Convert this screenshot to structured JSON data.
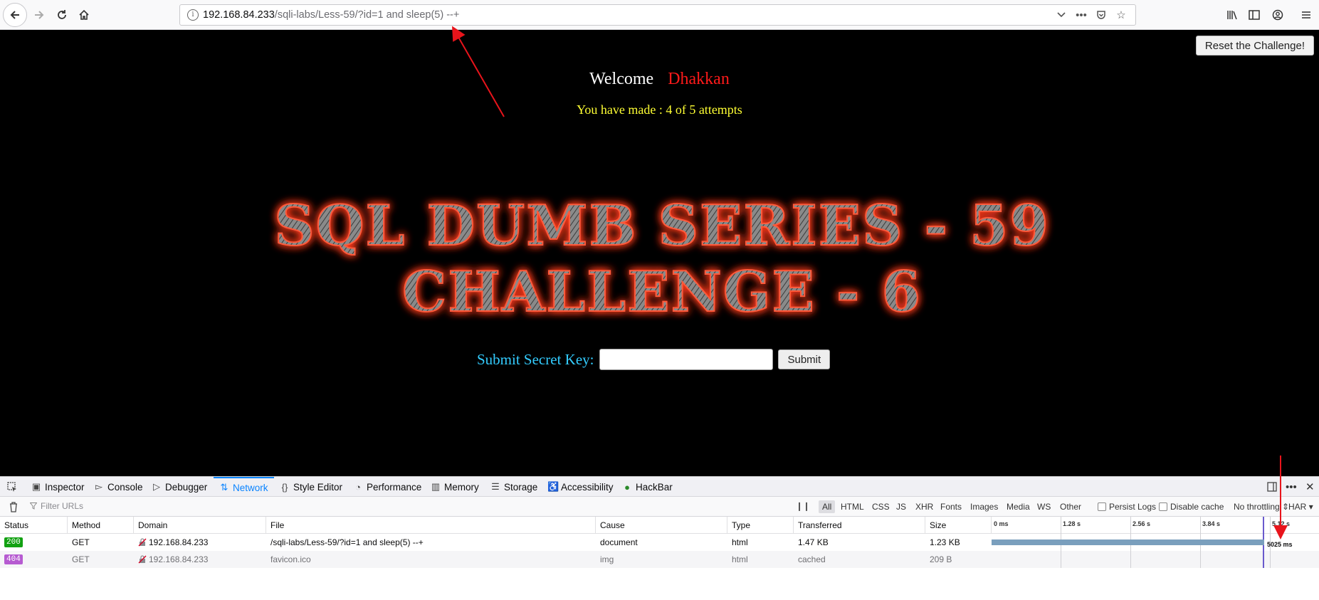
{
  "browser": {
    "url_host": "192.168.84.233",
    "url_path": "/sqli-labs/Less-59/?id=1 and sleep(5) --+",
    "icons": {
      "back": "arrow-left-icon",
      "forward": "arrow-right-icon",
      "reload": "reload-icon",
      "home": "home-icon",
      "info": "info-icon",
      "dropdown": "chevron-down-icon",
      "more": "more-dots-icon",
      "pocket": "pocket-icon",
      "bookmark": "star-icon",
      "library": "library-icon",
      "sidebar": "sidebar-icon",
      "account": "account-icon",
      "menu": "hamburger-menu-icon"
    }
  },
  "page": {
    "reset_label": "Reset the Challenge!",
    "welcome_label": "Welcome",
    "welcome_name": "Dhakkan",
    "attempts_text": "You have made : 4 of 5 attempts",
    "title_line1": "SQL DUMB SERIES - 59",
    "title_line2": "CHALLENGE - 6",
    "secret_label": "Submit Secret Key:",
    "secret_value": "",
    "submit_label": "Submit",
    "colors": {
      "background": "#000000",
      "welcome": "#ffffff",
      "name": "#ff1a1a",
      "attempts": "#ffff33",
      "secret_label": "#33ccff",
      "title_glow": "#ff3b1f"
    }
  },
  "devtools": {
    "tabs": [
      {
        "label": "Inspector",
        "icon": "inspector-icon"
      },
      {
        "label": "Console",
        "icon": "console-icon"
      },
      {
        "label": "Debugger",
        "icon": "debugger-icon"
      },
      {
        "label": "Network",
        "icon": "network-icon",
        "active": true
      },
      {
        "label": "Style Editor",
        "icon": "braces-icon"
      },
      {
        "label": "Performance",
        "icon": "gauge-icon"
      },
      {
        "label": "Memory",
        "icon": "memory-icon"
      },
      {
        "label": "Storage",
        "icon": "storage-icon"
      },
      {
        "label": "Accessibility",
        "icon": "accessibility-icon"
      },
      {
        "label": "HackBar",
        "icon": "hackbar-icon"
      }
    ],
    "filter_placeholder": "Filter URLs",
    "type_filters": [
      "All",
      "HTML",
      "CSS",
      "JS",
      "XHR",
      "Fonts",
      "Images",
      "Media",
      "WS",
      "Other"
    ],
    "persist_logs": "Persist Logs",
    "disable_cache": "Disable cache",
    "throttling": "No throttling",
    "har": "HAR",
    "columns": [
      "Status",
      "Method",
      "Domain",
      "File",
      "Cause",
      "Type",
      "Transferred",
      "Size"
    ],
    "timeline_ticks": [
      "0 ms",
      "1.28 s",
      "2.56 s",
      "3.84 s",
      "5.12 s"
    ],
    "requests": [
      {
        "status": "200",
        "status_color": "#12a112",
        "method": "GET",
        "domain": "192.168.84.233",
        "file": "/sqli-labs/Less-59/?id=1 and sleep(5) --+",
        "cause": "document",
        "type": "html",
        "transferred": "1.47 KB",
        "size": "1.23 KB",
        "timing": "5025 ms",
        "duration_ms": 5025
      },
      {
        "status": "404",
        "status_color": "#b65bd1",
        "method": "GET",
        "domain": "192.168.84.233",
        "file": "favicon.ico",
        "cause": "img",
        "type": "html",
        "transferred": "cached",
        "size": "209 B"
      }
    ]
  }
}
